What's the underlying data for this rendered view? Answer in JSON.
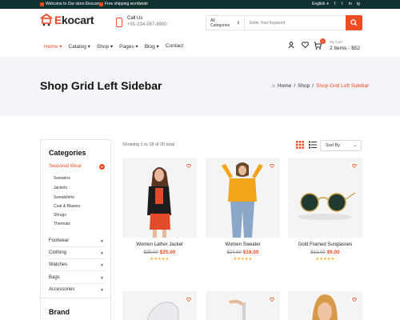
{
  "topbar": {
    "welcome": "Welcome to Our store Ekocart",
    "shipping": "Free shipping worldwide",
    "language": "English",
    "social": [
      "f",
      "t",
      "in",
      "ig"
    ]
  },
  "header": {
    "logo_e": "E",
    "logo_rest": "kocart",
    "call_label": "Call Us",
    "call_number": "+91-234-567-8900",
    "search_category": "All Categories",
    "search_placeholder": "Enter Your Keyword",
    "nav": [
      "Home",
      "Catalog",
      "Shop",
      "Pages",
      "Blog",
      "Contact"
    ],
    "cart_count": "2",
    "cart_label": "My Cart",
    "cart_summary": "2 Items - $52"
  },
  "hero": {
    "title": "Shop Grid Left Sidebar",
    "crumbs": [
      "Home",
      "/",
      "Shop",
      "/",
      "Shop Grid Left Sidebar"
    ]
  },
  "sidebar": {
    "title": "Categories",
    "open_category": "Seasonal Wear",
    "subcategories": [
      "Sweaters",
      "Jackets",
      "Sweatshirts",
      "Coat & Blazers",
      "Shrugs",
      "Thermals"
    ],
    "categories": [
      "Footwear",
      "Clothing",
      "Watches",
      "Bags",
      "Accessories"
    ],
    "brand_title": "Brand"
  },
  "toolbar": {
    "showing": "Showing 1 to 18 of 20 total",
    "sort_label": "Sort By"
  },
  "products": [
    {
      "name": "Women Lather Jacket",
      "old_price": "$35.00",
      "new_price": "$25.00",
      "stars": "★★★★★"
    },
    {
      "name": "Women Sweater",
      "old_price": "$24.00",
      "new_price": "$18.00",
      "stars": "★★★★★"
    },
    {
      "name": "Gold Framed Sunglasses",
      "old_price": "$12.00",
      "new_price": "$9.00",
      "stars": "★★★★★"
    }
  ],
  "colors": {
    "accent": "#ef4b23",
    "topbar": "#12322f",
    "hero_bg": "#f2f4f8"
  }
}
